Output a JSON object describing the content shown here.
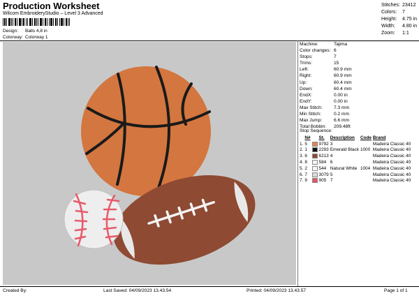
{
  "header": {
    "title": "Production Worksheet",
    "subtitle": "Wilcom EmbroideryStudio – Level 3 Advanced",
    "design_label": "Design:",
    "design_value": "Balls 4,8 in",
    "colorway_label": "Colorway:",
    "colorway_value": "Colorway 1"
  },
  "stats": [
    {
      "k": "Stitches:",
      "v": "23412"
    },
    {
      "k": "Colors:",
      "v": "7"
    },
    {
      "k": "Height:",
      "v": "4.75 in"
    },
    {
      "k": "Width:",
      "v": "4.80 in"
    },
    {
      "k": "Zoom:",
      "v": "1:1"
    }
  ],
  "info": [
    {
      "k": "Machine:",
      "v": "Tajima"
    },
    {
      "k": "Color changes:",
      "v": "6"
    },
    {
      "k": "Stops:",
      "v": "7"
    },
    {
      "k": "Trims:",
      "v": "15"
    },
    {
      "k": "Left:",
      "v": "60.9 mm"
    },
    {
      "k": "Right:",
      "v": "60.9 mm"
    },
    {
      "k": "Up:",
      "v": "60.4 mm"
    },
    {
      "k": "Down:",
      "v": "60.4 mm"
    },
    {
      "k": "EndX:",
      "v": "0.00 in"
    },
    {
      "k": "EndY:",
      "v": "0.00 in"
    },
    {
      "k": "Max Stitch:",
      "v": "7.3 mm"
    },
    {
      "k": "Min Stitch:",
      "v": "0.2 mm"
    },
    {
      "k": "Max Jump:",
      "v": "6.6 mm"
    },
    {
      "k": "Total Bobbin:",
      "v": "209.48ft"
    }
  ],
  "stop_sequence": {
    "title": "Stop Sequence:",
    "headers": [
      "",
      "N#",
      "",
      "St.",
      "Description",
      "Code",
      "Brand"
    ],
    "rows": [
      {
        "stop": "1.",
        "n": "5",
        "color": "#e8805a",
        "st": "9792",
        "desc": "3",
        "code": "",
        "brand": "Madeira Classic 40"
      },
      {
        "stop": "2.",
        "n": "1",
        "color": "#111111",
        "st": "2293",
        "desc": "Emerald Black",
        "code": "1000",
        "brand": "Madeira Classic 40"
      },
      {
        "stop": "3.",
        "n": "6",
        "color": "#8a4a32",
        "st": "6213",
        "desc": "4",
        "code": "",
        "brand": "Madeira Classic 40"
      },
      {
        "stop": "4.",
        "n": "8",
        "color": "#f4f4f4",
        "st": "584",
        "desc": "6",
        "code": "",
        "brand": "Madeira Classic 40"
      },
      {
        "stop": "5.",
        "n": "2",
        "color": "#f8f8f8",
        "st": "544",
        "desc": "Natural White",
        "code": "1004",
        "brand": "Madeira Classic 40"
      },
      {
        "stop": "6.",
        "n": "7",
        "color": "#dcdcdc",
        "st": "3079",
        "desc": "5",
        "code": "",
        "brand": "Madeira Classic 40"
      },
      {
        "stop": "7.",
        "n": "9",
        "color": "#e8506a",
        "st": "905",
        "desc": "7",
        "code": "",
        "brand": "Madeira Classic 40"
      }
    ]
  },
  "footer": {
    "created": "Created By:",
    "saved": "Last Saved: 04/09/2023 13.43.54",
    "printed": "Printed: 04/09/2023 13.43.57",
    "page": "Page 1 of 1"
  },
  "colors": {
    "basketball": "#d4763f",
    "football": "#8e4a33",
    "baseball_stitch": "#e85a6a",
    "canvas_bg": "#c8c8c8"
  }
}
